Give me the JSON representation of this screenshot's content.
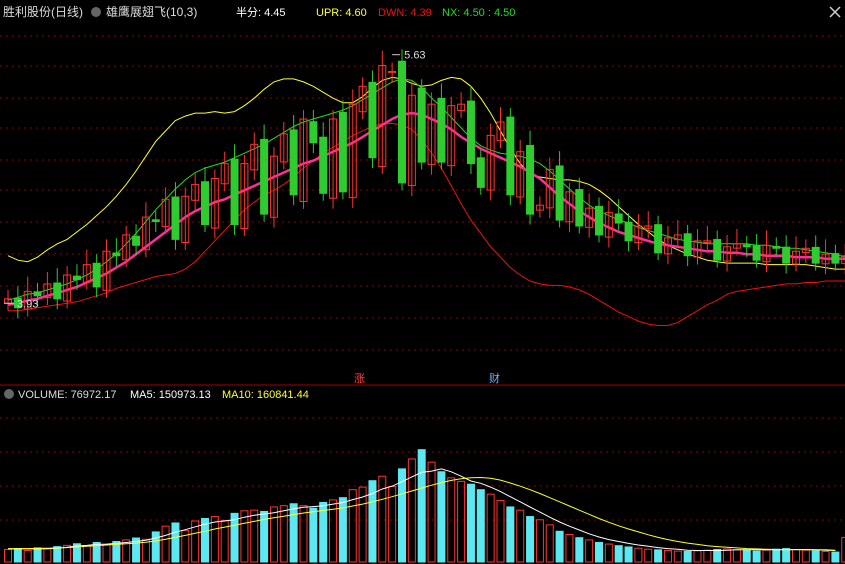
{
  "header": {
    "stock": "胜利股份(日线)",
    "indicator": "雄鹰展翅飞(10,3)",
    "half_label": "半分: 4.45",
    "upr": "UPR: 4.60",
    "dwn": "DWN: 4.39",
    "nx": "NX: 4.50 : 4.50"
  },
  "volume_header": {
    "volume": "VOLUME: 76972.17",
    "ma5": "MA5: 150973.13",
    "ma10": "MA10: 160841.44"
  },
  "markers": {
    "zhang": "涨",
    "cai": "财"
  },
  "annotations": {
    "high": "5.63",
    "low": "3.93"
  },
  "colors": {
    "up": "#ff3232",
    "down": "#2ecc2e",
    "vol_down": "#5ce8f0",
    "upper_band": "#ffff33",
    "mid_band": "#22dd22",
    "lower_band": "#ee1111",
    "ma": "#ff2ea0",
    "grid": "#8a0000",
    "ma5": "#ffffff",
    "ma10": "#ffff33"
  },
  "chart_data": [
    {
      "type": "candlestick",
      "ylim": [
        3.4,
        5.85
      ],
      "high": 5.63,
      "low": 3.93,
      "upper": [
        4.25,
        4.22,
        4.21,
        4.24,
        4.29,
        4.33,
        4.36,
        4.41,
        4.46,
        4.52,
        4.58,
        4.65,
        4.73,
        4.82,
        4.92,
        5.02,
        5.09,
        5.16,
        5.19,
        5.21,
        5.21,
        5.22,
        5.21,
        5.22,
        5.26,
        5.31,
        5.37,
        5.42,
        5.44,
        5.44,
        5.42,
        5.39,
        5.35,
        5.31,
        5.28,
        5.28,
        5.32,
        5.38,
        5.43,
        5.45,
        5.44,
        5.41,
        5.39,
        5.4,
        5.43,
        5.45,
        5.44,
        5.39,
        5.31,
        5.21,
        5.09,
        4.97,
        4.87,
        4.8,
        4.78,
        4.77,
        4.76,
        4.76,
        4.75,
        4.73,
        4.69,
        4.64,
        4.58,
        4.52,
        4.46,
        4.41,
        4.36,
        4.32,
        4.29,
        4.26,
        4.24,
        4.22,
        4.21,
        4.2,
        4.2,
        4.2,
        4.2,
        4.19,
        4.19,
        4.19,
        4.19,
        4.19,
        4.18,
        4.17,
        4.16,
        4.16
      ],
      "middle": [
        3.95,
        3.97,
        3.99,
        4.0,
        4.02,
        4.04,
        4.06,
        4.09,
        4.12,
        4.16,
        4.21,
        4.26,
        4.33,
        4.4,
        4.48,
        4.56,
        4.63,
        4.7,
        4.76,
        4.81,
        4.84,
        4.86,
        4.88,
        4.91,
        4.94,
        4.97,
        5.0,
        5.04,
        5.08,
        5.12,
        5.15,
        5.17,
        5.19,
        5.21,
        5.23,
        5.26,
        5.3,
        5.34,
        5.38,
        5.42,
        5.44,
        5.43,
        5.38,
        5.31,
        5.25,
        5.18,
        5.11,
        5.04,
        4.99,
        4.96,
        4.94,
        4.93,
        4.92,
        4.9,
        4.87,
        4.82,
        4.76,
        4.7,
        4.64,
        4.59,
        4.55,
        4.52,
        4.49,
        4.47,
        4.44,
        4.42,
        4.4,
        4.38,
        4.36,
        4.35,
        4.34,
        4.33,
        4.33,
        4.33,
        4.33,
        4.33,
        4.32,
        4.32,
        4.31,
        4.3,
        4.3,
        4.29,
        4.28,
        4.27,
        4.26,
        4.24
      ],
      "lower": [
        3.88,
        3.88,
        3.89,
        3.9,
        3.91,
        3.92,
        3.93,
        3.94,
        3.96,
        3.98,
        4.0,
        4.03,
        4.05,
        4.07,
        4.09,
        4.11,
        4.12,
        4.13,
        4.16,
        4.21,
        4.28,
        4.35,
        4.42,
        4.49,
        4.56,
        4.61,
        4.66,
        4.69,
        4.73,
        4.78,
        4.84,
        4.89,
        4.94,
        4.98,
        5.02,
        5.06,
        5.09,
        5.12,
        5.14,
        5.14,
        5.13,
        5.1,
        5.03,
        4.94,
        4.84,
        4.72,
        4.6,
        4.49,
        4.4,
        4.31,
        4.24,
        4.17,
        4.12,
        4.08,
        4.06,
        4.05,
        4.05,
        4.04,
        4.02,
        3.99,
        3.95,
        3.91,
        3.87,
        3.84,
        3.81,
        3.79,
        3.78,
        3.78,
        3.8,
        3.84,
        3.88,
        3.92,
        3.95,
        3.99,
        4.01,
        4.02,
        4.03,
        4.04,
        4.05,
        4.06,
        4.06,
        4.07,
        4.07,
        4.08,
        4.08,
        4.08
      ],
      "ma": [
        3.92,
        3.93,
        3.95,
        3.96,
        3.98,
        4.0,
        4.02,
        4.04,
        4.07,
        4.1,
        4.13,
        4.17,
        4.21,
        4.26,
        4.31,
        4.36,
        4.41,
        4.46,
        4.51,
        4.55,
        4.58,
        4.61,
        4.63,
        4.66,
        4.69,
        4.72,
        4.75,
        4.78,
        4.81,
        4.84,
        4.87,
        4.89,
        4.92,
        4.95,
        4.98,
        5.01,
        5.05,
        5.09,
        5.13,
        5.17,
        5.2,
        5.21,
        5.2,
        5.17,
        5.14,
        5.1,
        5.05,
        5.01,
        4.97,
        4.94,
        4.91,
        4.88,
        4.85,
        4.81,
        4.77,
        4.71,
        4.65,
        4.6,
        4.55,
        4.51,
        4.47,
        4.44,
        4.41,
        4.39,
        4.37,
        4.35,
        4.33,
        4.32,
        4.31,
        4.3,
        4.29,
        4.28,
        4.28,
        4.27,
        4.27,
        4.26,
        4.26,
        4.25,
        4.25,
        4.25,
        4.24,
        4.24,
        4.24,
        4.23,
        4.23,
        4.23
      ]
    },
    {
      "type": "bar",
      "title": "VOLUME",
      "ylim": [
        0,
        500000
      ],
      "volume": [
        39000,
        42000,
        36000,
        44000,
        41000,
        48000,
        52000,
        57000,
        50000,
        61000,
        55000,
        64000,
        69000,
        75000,
        71000,
        94000,
        112000,
        122000,
        98000,
        128000,
        136000,
        142000,
        130000,
        152000,
        160000,
        162000,
        158000,
        172000,
        176000,
        182000,
        176000,
        168000,
        186000,
        194000,
        201000,
        226000,
        234000,
        254000,
        268000,
        236000,
        291000,
        322000,
        351000,
        312000,
        282000,
        263000,
        252000,
        243000,
        226000,
        212000,
        192000,
        172000,
        162000,
        142000,
        132000,
        116000,
        96000,
        86000,
        76000,
        69000,
        61000,
        56000,
        51000,
        47000,
        43000,
        40000,
        38000,
        36000,
        34000,
        33000,
        35000,
        37000,
        39000,
        41000,
        38000,
        36000,
        34000,
        37000,
        40000,
        42000,
        39000,
        37000,
        35000,
        33000,
        31000,
        76972
      ],
      "ma5": [
        41000,
        41500,
        41000,
        41000,
        41500,
        43000,
        46000,
        50000,
        52000,
        55000,
        56000,
        58000,
        61000,
        64000,
        68000,
        75000,
        83000,
        93000,
        101000,
        110000,
        118000,
        125000,
        128000,
        132000,
        140000,
        146000,
        150000,
        154000,
        160000,
        166000,
        171000,
        173000,
        176000,
        181000,
        186000,
        195000,
        203000,
        214000,
        228000,
        237000,
        251000,
        266000,
        280000,
        284000,
        291000,
        282000,
        268000,
        253000,
        246000,
        234000,
        220000,
        204000,
        188000,
        172000,
        156000,
        140000,
        125000,
        112000,
        100000,
        88000,
        78000,
        70000,
        64000,
        58000,
        53000,
        49000,
        45000,
        42000,
        40000,
        37000,
        36000,
        36000,
        36000,
        37000,
        38000,
        38000,
        38000,
        38000,
        38000,
        38000,
        39000,
        39000,
        38000,
        37000,
        36000,
        150973
      ],
      "ma10": [
        42000,
        42000,
        42000,
        42500,
        43000,
        44000,
        45000,
        47000,
        49000,
        51000,
        53000,
        55000,
        57000,
        59000,
        62000,
        66000,
        71000,
        77000,
        83000,
        90000,
        96000,
        103000,
        109000,
        115000,
        121000,
        127000,
        133000,
        138000,
        143000,
        148000,
        153000,
        157000,
        161000,
        165000,
        169000,
        175000,
        181000,
        188000,
        196000,
        204000,
        213000,
        222000,
        231000,
        240000,
        248000,
        255000,
        260000,
        263000,
        264000,
        262000,
        256000,
        247000,
        237000,
        226000,
        214000,
        201000,
        188000,
        175000,
        162000,
        149000,
        136000,
        124000,
        113000,
        103000,
        94000,
        85000,
        77000,
        70000,
        64000,
        59000,
        55000,
        51000,
        48000,
        46000,
        44000,
        42000,
        41000,
        40000,
        39000,
        38000,
        38000,
        38000,
        38000,
        38000,
        37000,
        160841
      ]
    }
  ]
}
